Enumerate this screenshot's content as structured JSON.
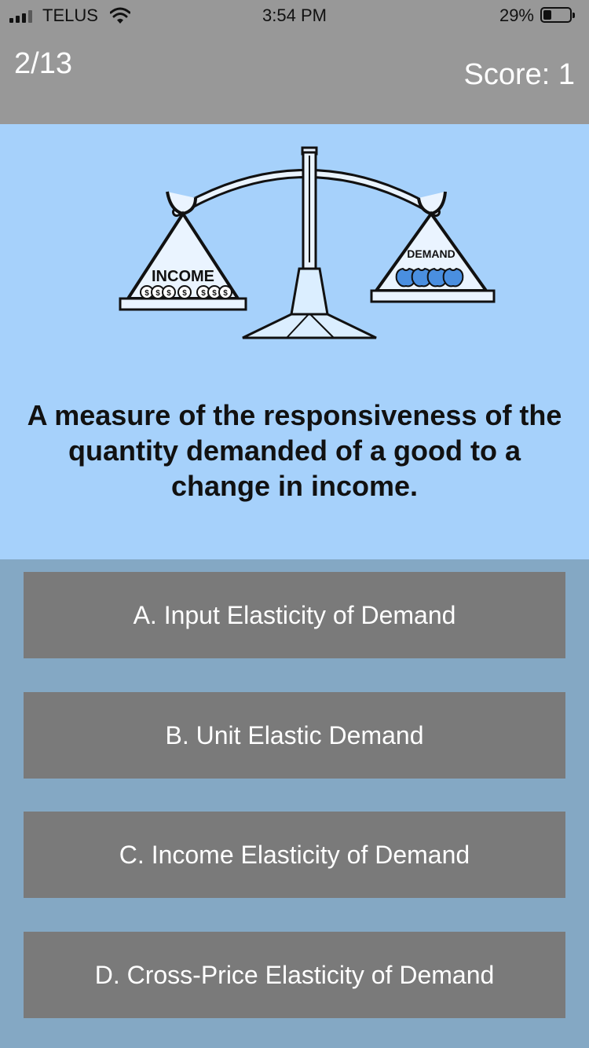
{
  "status_bar": {
    "carrier": "TELUS",
    "time": "3:54 PM",
    "battery_percent": "29%",
    "battery_level": 0.29,
    "signal_icon": "signal-bars-icon",
    "wifi_icon": "wifi-icon",
    "battery_icon": "battery-icon"
  },
  "quiz": {
    "progress": "2/13",
    "score": "Score: 1"
  },
  "illustration": {
    "left_pan_label": "INCOME",
    "right_pan_label": "DEMAND",
    "coin_symbol": "$",
    "icon": "balance-scale-icon"
  },
  "question": {
    "text": "A measure of the responsiveness of the quantity demanded of a good to a change in income."
  },
  "answers": [
    {
      "label": "A. Input Elasticity of Demand"
    },
    {
      "label": "B. Unit Elastic Demand"
    },
    {
      "label": "C. Income Elasticity of Demand"
    },
    {
      "label": "D. Cross-Price Elasticity of Demand"
    }
  ],
  "colors": {
    "header_bg": "#989898",
    "question_bg": "#a6d1fb",
    "answers_bg": "#84a8c4",
    "answer_button_bg": "#7a7a7a"
  }
}
